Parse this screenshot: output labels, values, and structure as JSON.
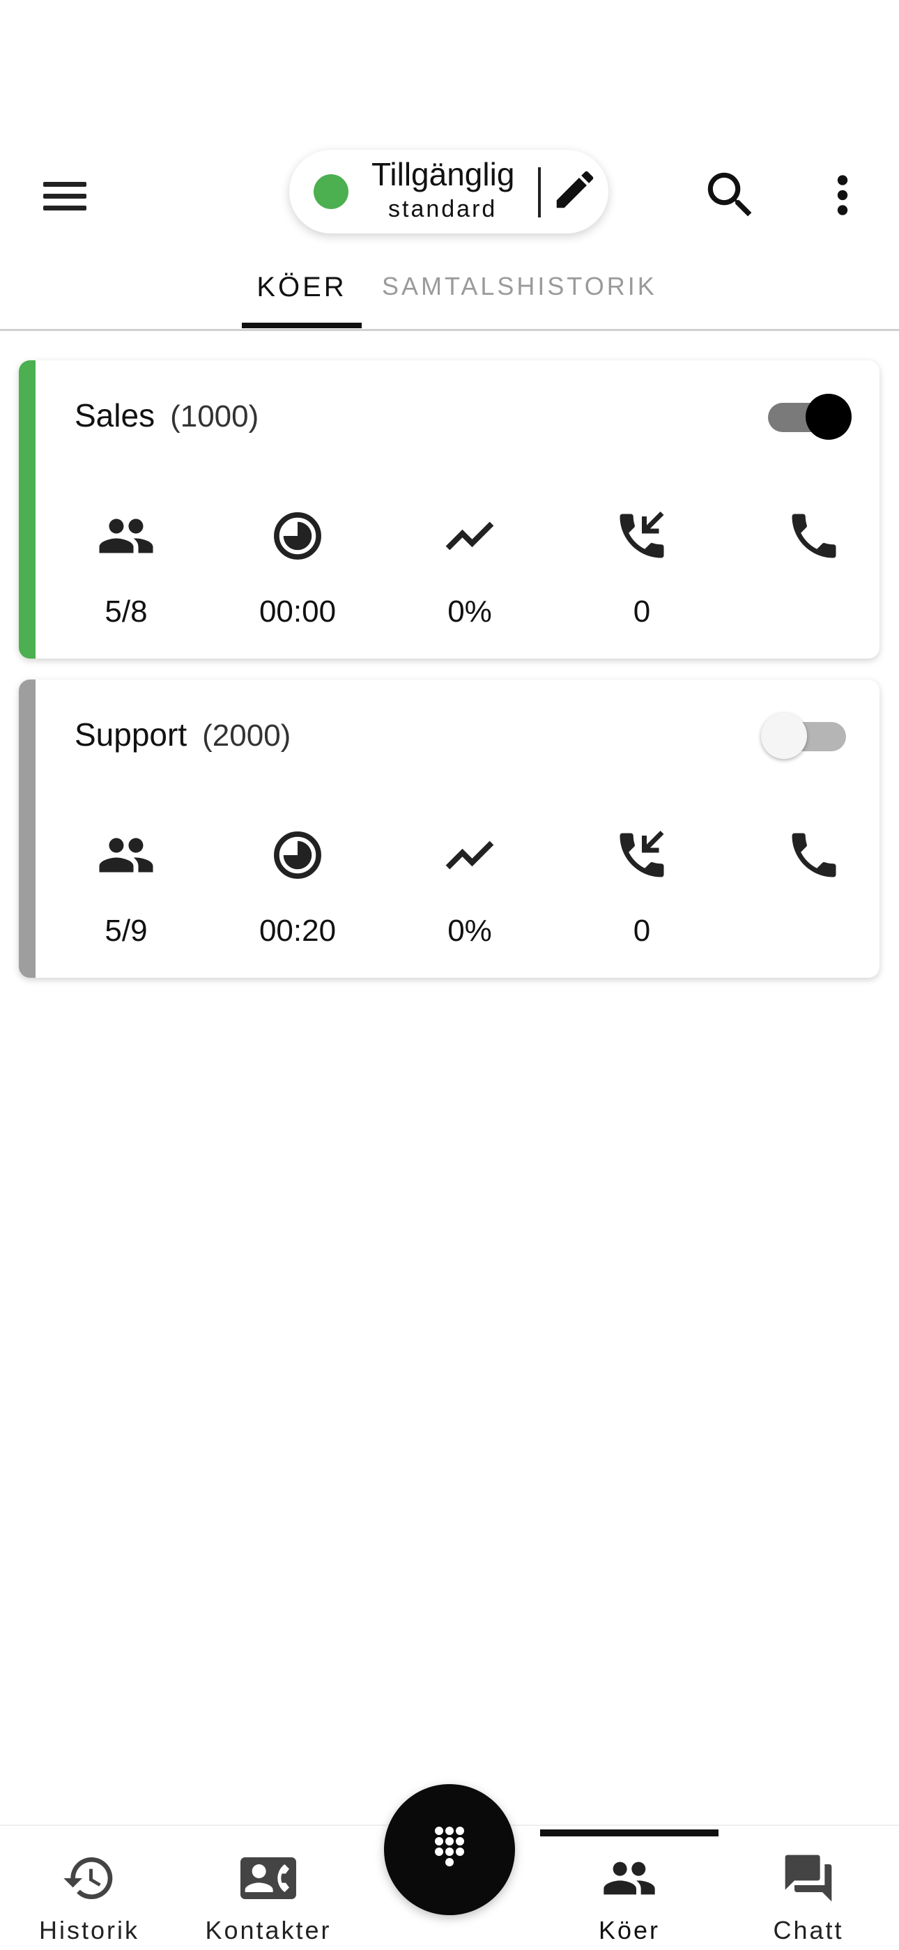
{
  "header": {
    "status_title": "Tillgänglig",
    "status_subtitle": "standard",
    "status_color": "#4CAF50",
    "icons": [
      "menu-icon",
      "edit-icon",
      "search-icon",
      "more-vert-icon"
    ]
  },
  "tabs": [
    {
      "label": "KÖER",
      "active": true
    },
    {
      "label": "SAMTALSHISTORIK",
      "active": false
    }
  ],
  "queues": [
    {
      "name": "Sales",
      "extension": "(1000)",
      "active": true,
      "accent_color": "#4CAF50",
      "agents": "5/8",
      "wait_time": "00:00",
      "rate": "0%",
      "incoming": "0"
    },
    {
      "name": "Support",
      "extension": "(2000)",
      "active": false,
      "accent_color": "#9E9E9E",
      "agents": "5/9",
      "wait_time": "00:20",
      "rate": "0%",
      "incoming": "0"
    }
  ],
  "bottom_nav": [
    {
      "label": "Historik",
      "icon": "history-icon",
      "active": false
    },
    {
      "label": "Kontakter",
      "icon": "contact-phone-icon",
      "active": false
    },
    {
      "label": "Köer",
      "icon": "people-icon",
      "active": true
    },
    {
      "label": "Chatt",
      "icon": "chat-icon",
      "active": false
    }
  ],
  "fab": {
    "icon": "dialpad-icon"
  }
}
